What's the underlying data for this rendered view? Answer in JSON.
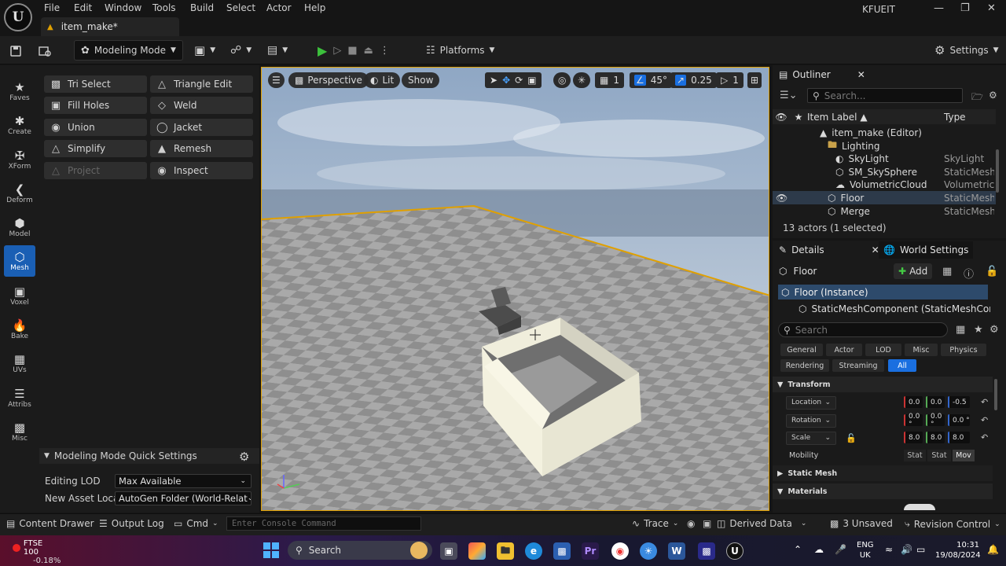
{
  "app": {
    "title": "KFUEIT",
    "logo": "U",
    "doc_tab": "item_make*"
  },
  "menu": [
    "File",
    "Edit",
    "Window",
    "Tools",
    "Build",
    "Select",
    "Actor",
    "Help"
  ],
  "toolbar": {
    "mode_label": "Modeling Mode",
    "platforms_label": "Platforms",
    "settings_label": "Settings"
  },
  "strip": [
    {
      "label": "Faves",
      "icon": "star-icon"
    },
    {
      "label": "Create",
      "icon": "create-icon"
    },
    {
      "label": "XForm",
      "icon": "xform-icon"
    },
    {
      "label": "Deform",
      "icon": "deform-icon"
    },
    {
      "label": "Model",
      "icon": "model-icon"
    },
    {
      "label": "Mesh",
      "icon": "mesh-icon",
      "active": true
    },
    {
      "label": "Voxel",
      "icon": "voxel-icon"
    },
    {
      "label": "Bake",
      "icon": "bake-icon"
    },
    {
      "label": "UVs",
      "icon": "uvs-icon"
    },
    {
      "label": "Attribs",
      "icon": "attribs-icon"
    },
    {
      "label": "Misc",
      "icon": "misc-icon"
    }
  ],
  "tools": [
    {
      "label": "Tri Select",
      "icon": "tri-select-icon"
    },
    {
      "label": "Triangle Edit",
      "icon": "triangle-edit-icon"
    },
    {
      "label": "Fill Holes",
      "icon": "fill-holes-icon"
    },
    {
      "label": "Weld",
      "icon": "weld-icon"
    },
    {
      "label": "Union",
      "icon": "union-icon"
    },
    {
      "label": "Jacket",
      "icon": "jacket-icon"
    },
    {
      "label": "Simplify",
      "icon": "simplify-icon"
    },
    {
      "label": "Remesh",
      "icon": "remesh-icon"
    },
    {
      "label": "Project",
      "icon": "project-icon",
      "disabled": true
    },
    {
      "label": "Inspect",
      "icon": "inspect-icon"
    }
  ],
  "quick_settings": {
    "title": "Modeling Mode Quick Settings",
    "editing_lod_label": "Editing LOD",
    "editing_lod_value": "Max Available",
    "new_asset_label": "New Asset Locati",
    "new_asset_value": "AutoGen Folder (World-Relat"
  },
  "viewport": {
    "perspective": "Perspective",
    "lit": "Lit",
    "show": "Show",
    "grid": "1",
    "angle": "45°",
    "scale": "0.25",
    "camera": "1"
  },
  "outliner": {
    "title": "Outliner",
    "search_placeholder": "Search...",
    "col_label": "Item Label",
    "col_type": "Type",
    "rows": [
      {
        "label": "item_make (Editor)",
        "type": "",
        "indent": 1
      },
      {
        "label": "Lighting",
        "type": "",
        "indent": 2
      },
      {
        "label": "SkyLight",
        "type": "SkyLight",
        "indent": 3
      },
      {
        "label": "SM_SkySphere",
        "type": "StaticMeshA",
        "indent": 3
      },
      {
        "label": "VolumetricCloud",
        "type": "VolumetricC",
        "indent": 3
      },
      {
        "label": "Floor",
        "type": "StaticMeshA",
        "indent": 2,
        "selected": true
      },
      {
        "label": "Merge",
        "type": "StaticMeshA",
        "indent": 2
      }
    ],
    "footer": "13 actors (1 selected)"
  },
  "details": {
    "tab_details": "Details",
    "tab_world": "World Settings",
    "actor": "Floor",
    "add": "Add",
    "instance": "Floor (Instance)",
    "component": "StaticMeshComponent (StaticMeshCompor",
    "search_placeholder": "Search",
    "filters": [
      "General",
      "Actor",
      "LOD",
      "Misc",
      "Physics",
      "Rendering",
      "Streaming",
      "All"
    ],
    "transform": "Transform",
    "location": {
      "label": "Location",
      "x": "0.0",
      "y": "0.0",
      "z": "-0.5"
    },
    "rotation": {
      "label": "Rotation",
      "x": "0.0 °",
      "y": "0.0 °",
      "z": "0.0 °"
    },
    "scale": {
      "label": "Scale",
      "x": "8.0",
      "y": "8.0",
      "z": "8.0"
    },
    "mobility": {
      "label": "Mobility",
      "opts": [
        "Stat",
        "Stat",
        "Mov"
      ]
    },
    "static_mesh": "Static Mesh",
    "materials": "Materials"
  },
  "bottom": {
    "content_drawer": "Content Drawer",
    "output_log": "Output Log",
    "cmd": "Cmd",
    "console_placeholder": "Enter Console Command",
    "trace": "Trace",
    "derived_data": "Derived Data",
    "unsaved": "3 Unsaved",
    "revision": "Revision Control"
  },
  "taskbar": {
    "stock_name": "FTSE 100",
    "stock_change": "-0.18%",
    "search": "Search",
    "lang1": "ENG",
    "lang2": "UK",
    "time": "10:31",
    "date": "19/08/2024"
  }
}
